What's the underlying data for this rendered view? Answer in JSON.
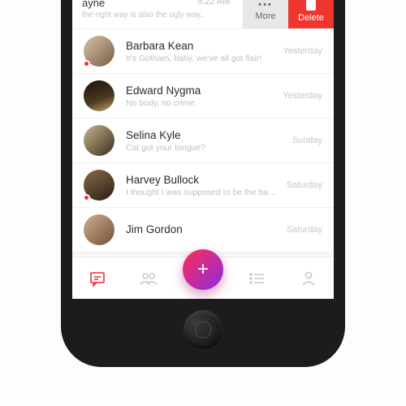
{
  "swiped": {
    "name": "ayne",
    "time": "9:22 AM",
    "preview": "the right way is also the ugly way..",
    "more_label": "More",
    "delete_label": "Delete"
  },
  "conversations": [
    {
      "name": "Barbara Kean",
      "preview": "It's Gotham, baby, we've all got flair!",
      "time": "Yesterday",
      "unread": true
    },
    {
      "name": "Edward Nygma",
      "preview": "No body, no crime.",
      "time": "Yesterday",
      "unread": false
    },
    {
      "name": "Selina Kyle",
      "preview": "Cat got your tongue?",
      "time": "Sunday",
      "unread": false
    },
    {
      "name": "Harvey Bullock",
      "preview": "I thought I was supposed to be the bad guy here?",
      "time": "Saturday",
      "unread": true
    },
    {
      "name": "Jim Gordon",
      "preview": "",
      "time": "Saturday",
      "unread": false
    }
  ],
  "fab_label": "+"
}
